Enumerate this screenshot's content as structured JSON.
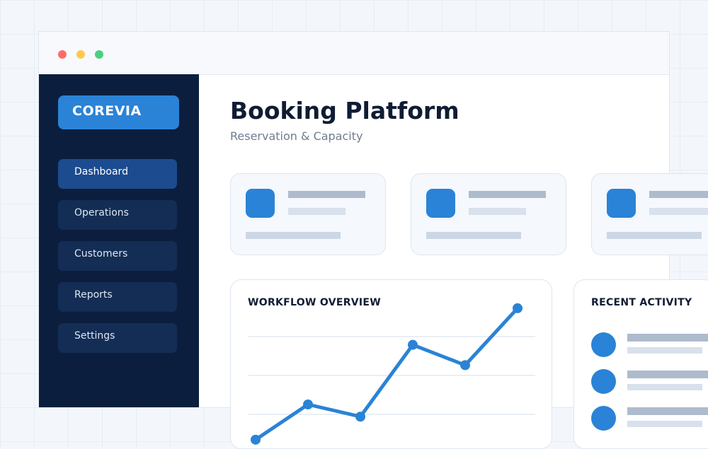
{
  "window": {
    "controls": [
      "close",
      "minimize",
      "maximize"
    ],
    "control_colors": [
      "#ff6b6b",
      "#ffc94d",
      "#4cd080"
    ]
  },
  "sidebar": {
    "brand": "COREVIA",
    "items": [
      {
        "label": "Dashboard",
        "active": true
      },
      {
        "label": "Operations",
        "active": false
      },
      {
        "label": "Customers",
        "active": false
      },
      {
        "label": "Reports",
        "active": false
      },
      {
        "label": "Settings",
        "active": false
      }
    ]
  },
  "main": {
    "title": "Booking Platform",
    "subtitle": "Reservation & Capacity"
  },
  "workflow": {
    "title": "WORKFLOW OVERVIEW"
  },
  "activity": {
    "title": "RECENT ACTIVITY"
  },
  "colors": {
    "accent": "#2a83d6",
    "sidebar_bg": "#0c1e3e",
    "nav_item_bg": "#142d54",
    "nav_active_bg": "#1d4b8f"
  },
  "chart_data": {
    "type": "line",
    "title": "WORKFLOW OVERVIEW",
    "series": [
      {
        "values": [
          1,
          3.6,
          2.7,
          8,
          6.5,
          10.7
        ]
      }
    ],
    "ylim": [
      0,
      12
    ],
    "grid": true,
    "legend": "none"
  }
}
